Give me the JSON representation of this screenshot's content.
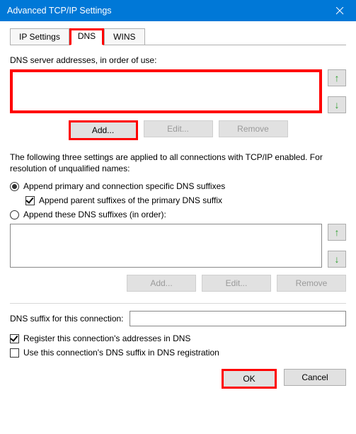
{
  "window": {
    "title": "Advanced TCP/IP Settings"
  },
  "tabs": {
    "ip": "IP Settings",
    "dns": "DNS",
    "wins": "WINS"
  },
  "dns": {
    "servers_label": "DNS server addresses, in order of use:",
    "add": "Add...",
    "edit": "Edit...",
    "remove": "Remove",
    "note": "The following three settings are applied to all connections with TCP/IP enabled. For resolution of unqualified names:",
    "radio_primary": "Append primary and connection specific DNS suffixes",
    "chk_parent": "Append parent suffixes of the primary DNS suffix",
    "radio_append": "Append these DNS suffixes (in order):",
    "add2": "Add...",
    "edit2": "Edit...",
    "remove2": "Remove",
    "suffix_label": "DNS suffix for this connection:",
    "suffix_value": "",
    "chk_register": "Register this connection's addresses in DNS",
    "chk_usesuffix": "Use this connection's DNS suffix in DNS registration"
  },
  "buttons": {
    "ok": "OK",
    "cancel": "Cancel"
  }
}
